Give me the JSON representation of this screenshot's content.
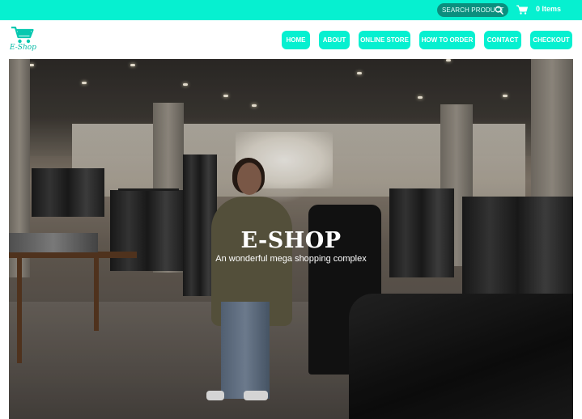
{
  "topbar": {
    "search_placeholder": "SEARCH PRODUCT",
    "cart_count": "0 Items",
    "color": "#06f0d0"
  },
  "header": {
    "logo_text": "E-Shop"
  },
  "nav": {
    "items": [
      "HOME",
      "ABOUT",
      "ONLINE STORE",
      "HOW TO ORDER",
      "CONTACT",
      "CHECKOUT"
    ]
  },
  "hero": {
    "title": "E-SHOP",
    "subtitle": "An wonderful mega shopping complex"
  },
  "icons": {
    "search": "search-icon",
    "cart": "cart-icon",
    "logo": "shopping-cart-logo-icon"
  }
}
